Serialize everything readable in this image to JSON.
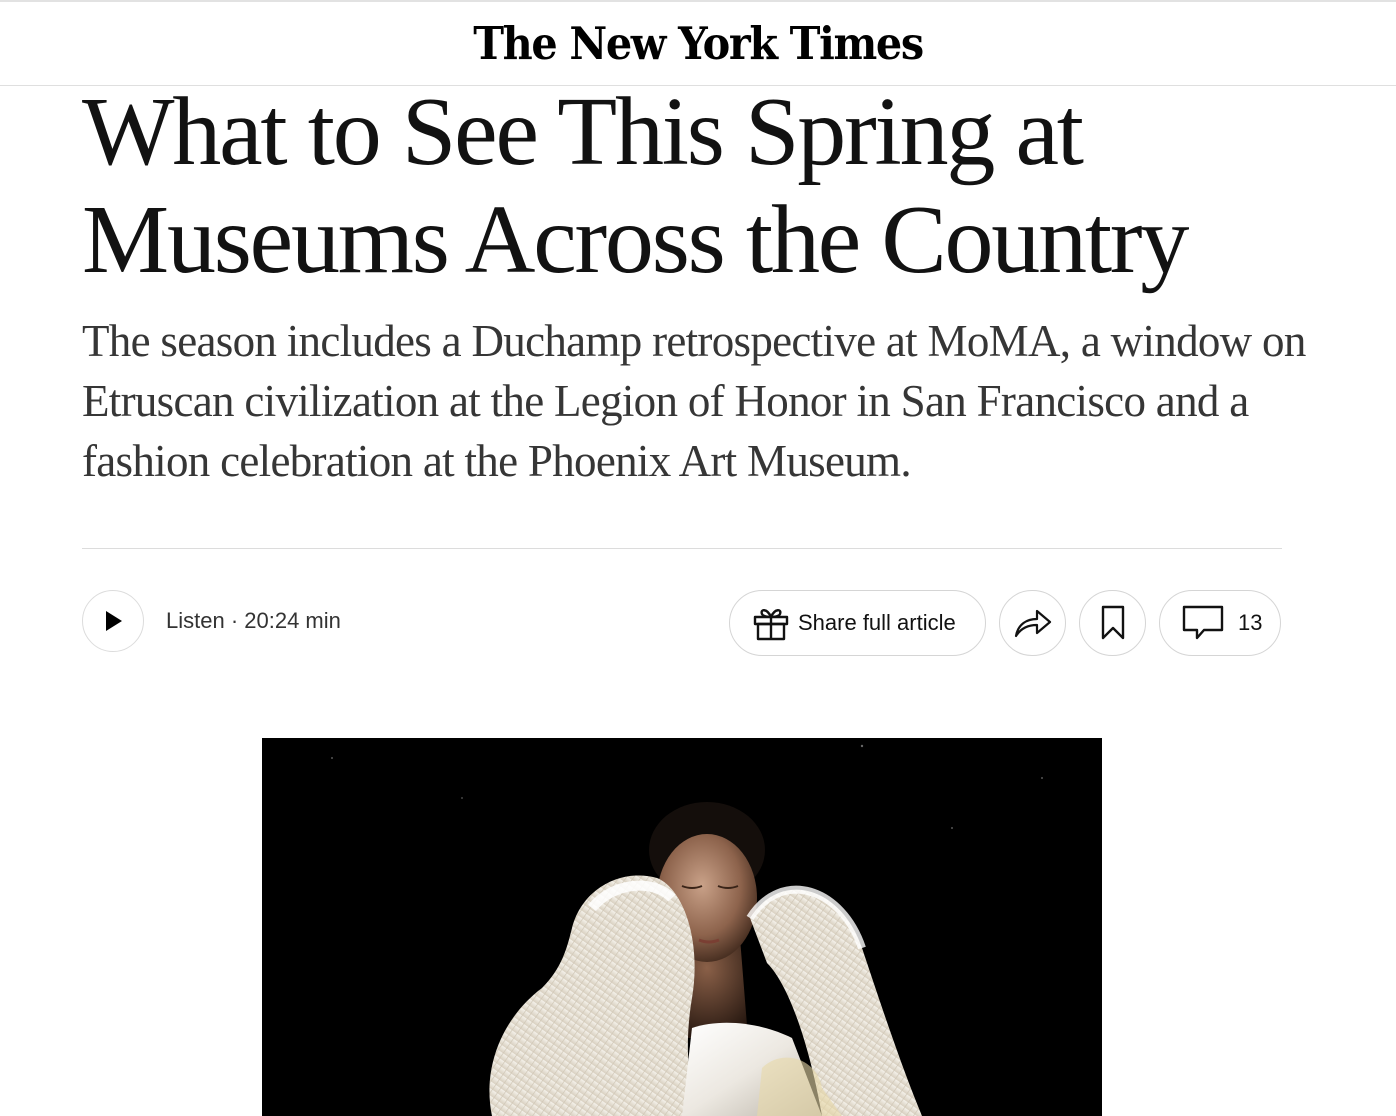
{
  "masthead": {
    "logo_text": "The New York Times"
  },
  "article": {
    "headline": "What to See This Spring at Museums Across the Country",
    "summary": "The season includes a Duchamp retrospective at MoMA, a window on Etruscan civilization at the Legion of Honor in San Francisco and a fashion celebration at the Phoenix Art Museum."
  },
  "audio": {
    "play_icon": "play-icon",
    "listen_label": "Listen · 20:24 min"
  },
  "actions": {
    "share_icon": "gift-icon",
    "share_label": "Share full article",
    "forward_icon": "share-arrow-icon",
    "bookmark_icon": "bookmark-icon",
    "comments_icon": "comment-icon",
    "comments_count": "13"
  },
  "hero_image": {
    "subject": "model with eyes closed wearing sculptural white ruffled garment against black background"
  }
}
